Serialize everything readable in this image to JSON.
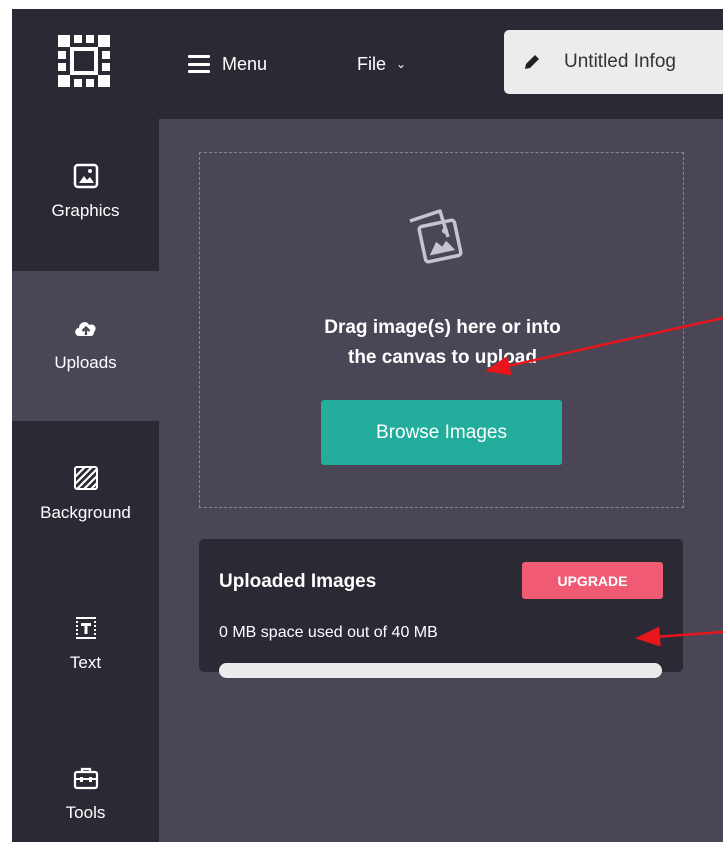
{
  "header": {
    "menu_label": "Menu",
    "file_label": "File",
    "document_title": "Untitled Infog"
  },
  "sidebar": {
    "items": [
      {
        "label": "Graphics",
        "icon": "image-icon"
      },
      {
        "label": "Uploads",
        "icon": "cloud-upload-icon",
        "active": true
      },
      {
        "label": "Background",
        "icon": "hatch-pattern-icon"
      },
      {
        "label": "Text",
        "icon": "text-box-icon"
      },
      {
        "label": "Tools",
        "icon": "toolbox-icon"
      }
    ]
  },
  "upload": {
    "drop_line1": "Drag image(s) here or into",
    "drop_line2": "the canvas to upload",
    "browse_label": "Browse Images",
    "icon": "stacked-images-icon"
  },
  "uploaded": {
    "title": "Uploaded Images",
    "upgrade_label": "UPGRADE",
    "usage_text": "0 MB space used out of 40 MB",
    "used_fraction": 0
  },
  "colors": {
    "panel_bg": "#4a4656",
    "sidebar_bg": "#2b2934",
    "accent_teal": "#22ad9c",
    "upgrade_pink": "#f05a72",
    "annotation_red": "#e8151b"
  }
}
